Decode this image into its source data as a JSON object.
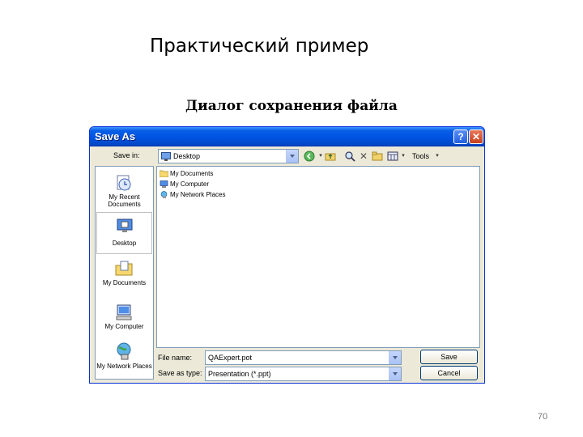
{
  "slide": {
    "title": "Практический пример",
    "subtitle": "Диалог сохранения файла",
    "page_number": "70"
  },
  "dialog": {
    "title": "Save As",
    "help_label": "?",
    "close_label": "✕",
    "save_in_label": "Save in:",
    "save_in_value": "Desktop",
    "tools_label": "Tools",
    "places": [
      {
        "label": "My Recent Documents",
        "icon": "recent-documents-icon"
      },
      {
        "label": "Desktop",
        "icon": "desktop-icon"
      },
      {
        "label": "My Documents",
        "icon": "my-documents-icon"
      },
      {
        "label": "My Computer",
        "icon": "my-computer-icon"
      },
      {
        "label": "My Network Places",
        "icon": "network-places-icon"
      }
    ],
    "files": [
      {
        "name": "My Documents",
        "icon": "folder-icon"
      },
      {
        "name": "My Computer",
        "icon": "computer-icon"
      },
      {
        "name": "My Network Places",
        "icon": "network-icon"
      }
    ],
    "file_name_label": "File name:",
    "file_name_value": "QAExpert.pot",
    "save_as_type_label": "Save as type:",
    "save_as_type_value": "Presentation (*.ppt)",
    "save_button": "Save",
    "cancel_button": "Cancel"
  },
  "colors": {
    "titlebar": "#0054e3",
    "dialog_bg": "#ece9d8",
    "field_border": "#7f9db9"
  }
}
